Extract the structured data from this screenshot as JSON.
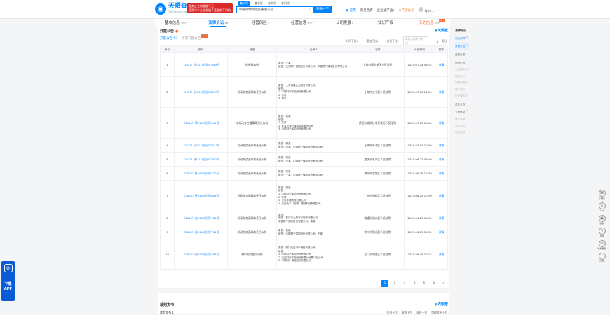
{
  "header": {
    "logo_cn": "天眼查",
    "logo_en": "TianYanCha.com",
    "ad_line1": "服务企业数量超千万",
    "ad_line2": "国家中小企业发展子基金旗下机构",
    "search_tabs": [
      "查公司",
      "查老板",
      "查关系",
      "查风险"
    ],
    "search_value": "中银财产保险股份有限公司",
    "search_button": "天眼一下",
    "nav": {
      "app": "应用",
      "commerce": "商务合作",
      "products": "企业级产品",
      "vip": "开通会员",
      "user": "fyx4..."
    }
  },
  "tabs": [
    {
      "label": "基本信息",
      "count": "999+"
    },
    {
      "label": "法律诉讼",
      "count": "79",
      "active": true
    },
    {
      "label": "经营风险",
      "count": "1"
    },
    {
      "label": "经营信息",
      "count": "999+"
    },
    {
      "label": "公司发展",
      "count": "8"
    },
    {
      "label": "知识产权",
      "count": "1"
    },
    {
      "label": "历史信息",
      "count": "99+",
      "hot": "HOT"
    }
  ],
  "section": {
    "title": "开庭公告",
    "brand": "天眼查",
    "subtabs": [
      "开庭公告 53",
      "历史开庭公告"
    ],
    "new_badge": "NEW",
    "filters": [
      "时间下拉",
      "案由下拉",
      "身份下拉"
    ],
    "search_placeholder": "请输入搜索关键词",
    "export": "导出"
  },
  "table": {
    "headers": [
      "序号",
      "案号",
      "案由",
      "当事人",
      "法院",
      "开庭时间",
      "操作"
    ],
    "rows": [
      {
        "no": "1",
        "case": "（2025）沪0115民初97068号",
        "cause": "追偿权纠纷",
        "parties": "原告：汪某\n被告：天安财产保险股份有限公司、中银财产保险股份有限公司",
        "court": "上海市浦东新区人民法院",
        "time": "2025-07-24 09:15",
        "op": "详情"
      },
      {
        "no": "2",
        "case": "（2025）沪0105民初16378号",
        "cause": "机动车交通事故责任纠纷",
        "parties": "原告：上海倍隆企业服务有限公司\n被告：\n1. 中银财产保险股份有限公司\n2. 李某\n3. 黄某",
        "court": "上海市长宁区人民法院",
        "time": "2025-07-16 14:15",
        "op": "详情"
      },
      {
        "no": "3",
        "case": "（2025）鄂0192民初5342号",
        "cause": "非机动车交通事故责任纠纷",
        "parties": "原告：刘某\n被告：\n1. 张某\n2. 武汉宏诚兴建筑劳务有限公司\n3. 中银财产保险股份有限公司",
        "court": "武汉东湖新技术开发区人民法院",
        "time": "2025-07-15 09:00",
        "op": "详情"
      },
      {
        "no": "4",
        "case": "（2025）沪0118民初12047号",
        "cause": "机动车交通事故责任纠纷",
        "parties": "原告：傅某\n被告：宋某、中银财产保险股份有限公司",
        "court": "上海市青浦区人民法院",
        "time": "2025-07-14 10:00",
        "op": "详情"
      },
      {
        "no": "5",
        "case": "（2025）渝0118民初11082号",
        "cause": "机动车交通事故责任纠纷",
        "parties": "原告：刘某\n被告：李某、中银财产保险股份有限公司",
        "court": "重庆市永川区人民法院",
        "time": "2025-06-27 09:40",
        "op": "详情"
      },
      {
        "no": "6",
        "case": "（2025）鲁1602民初3470号",
        "cause": "机动车交通事故责任纠纷",
        "parties": "原告：张某\n被告：王某、中银财产保险股份有限公司",
        "court": "滨州市滨城区人民法院",
        "time": "2025-06-26 15:30",
        "op": "详情"
      },
      {
        "no": "7",
        "case": "（2025）粤0105民初8605号",
        "cause": "机动车交通事故责任纠纷",
        "parties": "原告：唐某\n被告：\n1. 中银财产保险股份有限公司\n2. 李某\n3. 长沙中德物流有限公司\n4. 天达天下（安徽）物流科技有限公司",
        "court": "广州市海珠区人民法院",
        "time": "2025-06-25 10:30",
        "op": "详情"
      },
      {
        "no": "8",
        "case": "（2025）苏0105民初7186号",
        "cause": "机动车交通事故责任纠纷",
        "parties": "原告：\n被告：泰兴市山泉汽车服务有限公司\n中银财产保险股份有限公司、周某",
        "court": "南通市通州区人民法院",
        "time": "2025-06-23 09:30",
        "op": "详情"
      },
      {
        "no": "9",
        "case": "（2025）苏0116民初7781号",
        "cause": "机动车交通事故责任纠纷",
        "parties": "原告：张某\n被告：中银财产保险股份有限公司、王某",
        "court": "徐州市铜山区人民法院",
        "time": "2025-06-23 09:30",
        "op": "详情"
      },
      {
        "no": "10",
        "case": "（2025）闽0206民初7484号",
        "cause": "财产保险合同纠纷",
        "parties": "原告：厦门远安汽车销售有限公司\n被告：\n1. 中银财产保险股份有限公司\n2. 天安财产保险股份有限公司厦门分公司\n3. 中银财产保险股份有限公司",
        "court": "厦门市湖里区人民法院",
        "time": "2025-06-19 15:15",
        "op": "详情"
      }
    ]
  },
  "pagination": {
    "pages": [
      "1",
      "2",
      "3",
      "4",
      "5",
      "6",
      ">"
    ],
    "current": "1"
  },
  "section2": {
    "title": "裁判文书",
    "brand": "天眼查",
    "new_badge": "NEW",
    "sub": "裁判文书 1",
    "filters": [
      "年份下拉",
      "案由下拉",
      "身份下拉",
      "审理程序下拉"
    ]
  },
  "sidenav": {
    "head": "法律诉讼",
    "items": [
      {
        "label": "司法案件",
        "count": "63",
        "style": "b"
      },
      {
        "label": "开庭公告",
        "count": "53",
        "style": "hl"
      },
      {
        "label": "裁判文书",
        "count": "1",
        "style": "n"
      },
      {
        "label": "法院公告",
        "count": "4",
        "style": "n"
      },
      {
        "label": "失信被执行人",
        "count": "",
        "style": "g"
      },
      {
        "label": "被执行人",
        "count": "",
        "style": "g"
      },
      {
        "label": "限制消费令",
        "count": "",
        "style": "g"
      },
      {
        "label": "终本案件",
        "count": "",
        "style": "g"
      },
      {
        "label": "历史被执行",
        "count": "",
        "style": "g"
      },
      {
        "label": "送达公告",
        "count": "2",
        "style": "n"
      },
      {
        "label": "立案信息",
        "count": "15",
        "style": "n"
      },
      {
        "label": "破产重整",
        "count": "",
        "style": "g"
      },
      {
        "label": "司法拍卖",
        "count": "",
        "style": "g"
      },
      {
        "label": "股权冻结",
        "count": "",
        "style": "g"
      }
    ]
  },
  "float_app": {
    "line1": "下载",
    "line2": "APP"
  },
  "right_tools": [
    "小程序",
    "APP",
    "微信",
    "反馈",
    "联系客服",
    "回顶"
  ]
}
